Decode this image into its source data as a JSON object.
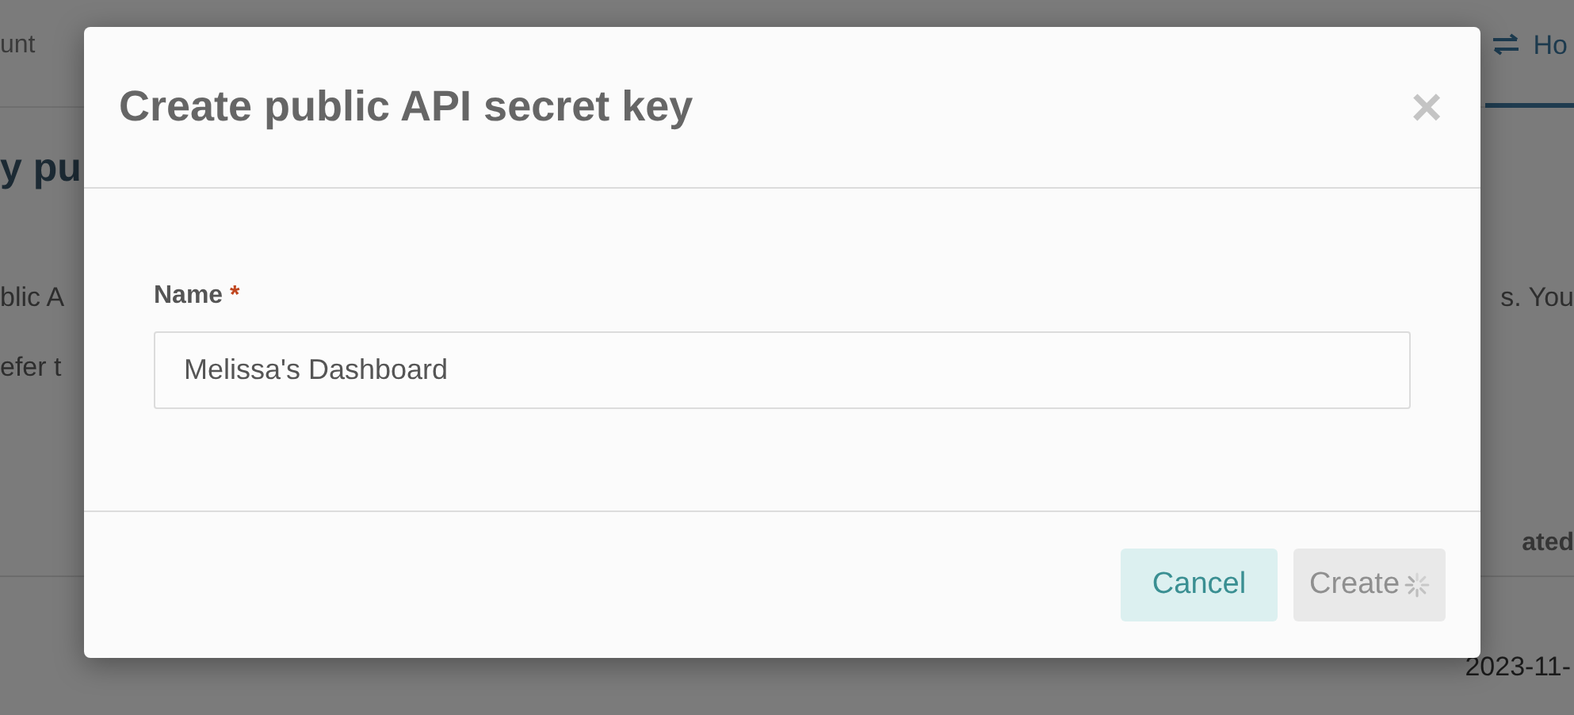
{
  "page": {
    "nav": {
      "left_text": "unt",
      "tab": {
        "label": "Ho",
        "selected": true
      }
    },
    "heading": "y pu",
    "paragraph_lines": [
      {
        "left": "blic A",
        "right": "s. You"
      },
      {
        "left": "efer t"
      }
    ],
    "table": {
      "header": {
        "right": "ated"
      },
      "rows": [
        {
          "right": "2023-11-"
        }
      ]
    }
  },
  "dialog": {
    "title": "Create public API secret key",
    "close": "×",
    "field": {
      "label": "Name",
      "required": true,
      "required_mark": "*",
      "value": "Melissa's Dashboard"
    },
    "buttons": [
      {
        "label": "Cancel",
        "kind": "cancel"
      },
      {
        "label": "Create",
        "kind": "primary",
        "disabled": true,
        "loading": true
      }
    ]
  }
}
